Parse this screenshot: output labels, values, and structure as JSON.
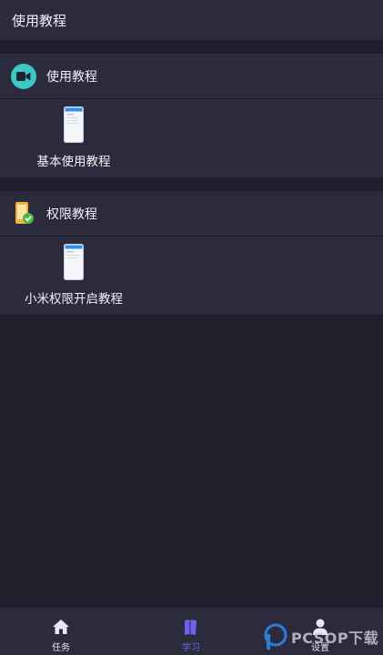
{
  "header": {
    "title": "使用教程"
  },
  "sections": [
    {
      "icon": "video-camera-icon",
      "title": "使用教程",
      "items": [
        {
          "label": "基本使用教程",
          "icon": "phone-screenshot-thumbnail"
        }
      ]
    },
    {
      "icon": "phone-permission-icon",
      "title": "权限教程",
      "items": [
        {
          "label": "小米权限开启教程",
          "icon": "phone-screenshot-thumbnail"
        }
      ]
    }
  ],
  "tabbar": {
    "tabs": [
      {
        "label": "任务",
        "icon": "home-icon",
        "active": false
      },
      {
        "label": "学习",
        "icon": "book-icon",
        "active": true
      },
      {
        "label": "设置",
        "icon": "user-icon",
        "active": false
      }
    ]
  },
  "watermark": {
    "text": "PCSOP下载"
  },
  "colors": {
    "background": "#1f1f2b",
    "panel": "#2b2b3d",
    "accent": "#6c63e8",
    "camera_badge": "#3cc8c6",
    "permission_check": "#4cb84c"
  }
}
